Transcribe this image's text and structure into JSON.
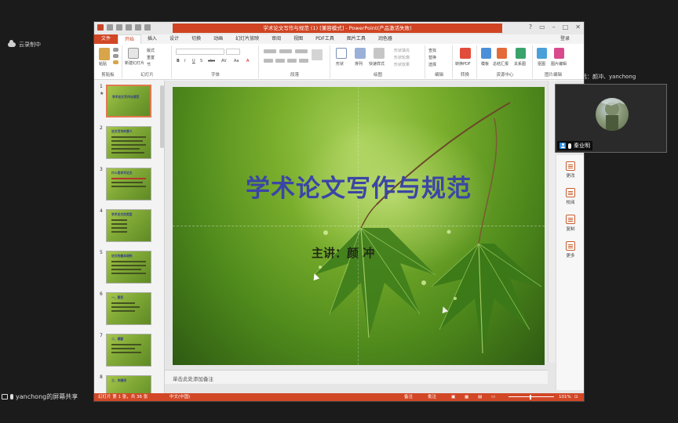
{
  "left_status": {
    "text": "云录制中"
  },
  "window": {
    "title": "学术论文写作与规范 (1) [兼容模式] - PowerPoint(产品激活失败)",
    "controls": [
      "?",
      "▭",
      "–",
      "□",
      "✕"
    ],
    "login": "登录"
  },
  "tabs": [
    "文件",
    "开始",
    "插入",
    "设计",
    "切换",
    "动画",
    "幻灯片放映",
    "审阅",
    "视图",
    "PDF工具",
    "图片工具",
    "润色器"
  ],
  "ribbon": {
    "groups": [
      {
        "label": "剪贴板",
        "items": [
          "粘贴"
        ]
      },
      {
        "label": "幻灯片",
        "items": [
          "新建幻灯片",
          "版式",
          "重置",
          "节"
        ]
      },
      {
        "label": "字体",
        "items": [
          "B",
          "I",
          "U",
          "S",
          "abc",
          "AV",
          "Aa",
          "A"
        ]
      },
      {
        "label": "段落",
        "items": []
      },
      {
        "label": "绘图",
        "items": [
          "形状",
          "排列",
          "快速样式",
          "形状填充",
          "形状轮廓",
          "形状效果"
        ]
      },
      {
        "label": "编辑",
        "items": [
          "查找",
          "替换",
          "选择"
        ]
      },
      {
        "label": "转换",
        "items": [
          "转换PDF"
        ]
      },
      {
        "label": "资源中心",
        "items": [
          "模板",
          "总结汇报",
          "关系图"
        ]
      },
      {
        "label": "图片编辑",
        "items": [
          "抠图",
          "图片编辑"
        ]
      }
    ]
  },
  "thumbnails": [
    {
      "num": "1",
      "title": "学术论文写作与规范",
      "selected": true
    },
    {
      "num": "2",
      "title": "论文写作的意义",
      "selected": false
    },
    {
      "num": "3",
      "title": "什么是学术论文",
      "selected": false
    },
    {
      "num": "4",
      "title": "学术论文的类型",
      "selected": false
    },
    {
      "num": "5",
      "title": "论文的基本结构",
      "selected": false
    },
    {
      "num": "6",
      "title": "一、题目",
      "selected": false
    },
    {
      "num": "7",
      "title": "二、摘要",
      "selected": false
    },
    {
      "num": "8",
      "title": "三、关键词",
      "selected": false
    }
  ],
  "slide": {
    "title": "学术论文写作与规范",
    "subtitle": "主讲：颜  冲"
  },
  "notes": {
    "placeholder": "单击此处添加备注"
  },
  "side_panel": {
    "items": [
      "更改",
      "校阅",
      "复制",
      "更多"
    ]
  },
  "status": {
    "slide_info": "幻灯片 第 1 张，共 36 张",
    "lang": "中文(中国)",
    "notes_btn": "备注",
    "comments_btn": "批注",
    "zoom": "101%"
  },
  "meeting": {
    "speaking": "正在讲话：颜冲、yanchong",
    "participant": "秦业明",
    "share_label": "yanchong的屏幕共享"
  },
  "colors": {
    "accent": "#d24726",
    "slide_title": "#3b45a6"
  }
}
